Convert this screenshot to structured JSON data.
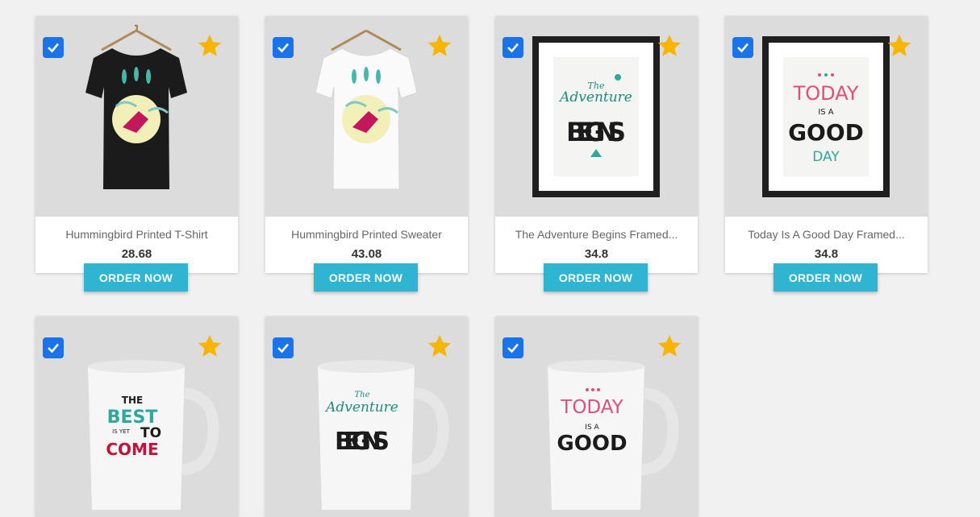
{
  "order_label": "ORDER NOW",
  "products": [
    {
      "name": "Hummingbird Printed T-Shirt",
      "price": "28.68",
      "image": "black-tshirt"
    },
    {
      "name": "Hummingbird Printed Sweater",
      "price": "43.08",
      "image": "white-tshirt"
    },
    {
      "name": "The Adventure Begins Framed...",
      "price": "34.8",
      "image": "framed-poster-adventure"
    },
    {
      "name": "Today Is A Good Day Framed...",
      "price": "34.8",
      "image": "framed-poster-today"
    },
    {
      "name": "",
      "price": "",
      "image": "mug-best-is-yet-to-come"
    },
    {
      "name": "",
      "price": "",
      "image": "mug-adventure-begins"
    },
    {
      "name": "",
      "price": "",
      "image": "mug-today-is-a-good-day"
    }
  ],
  "artwork_text": {
    "adventure_the": "The",
    "adventure_word": "Adventure",
    "adventure_begins": "BEGINS",
    "today_today": "TODAY",
    "today_isa": "IS A",
    "today_good": "GOOD",
    "today_day": "DAY",
    "best_the": "THE",
    "best_best": "BEST",
    "best_isyet": "IS YET",
    "best_to": "TO",
    "best_come": "COME"
  },
  "colors": {
    "checkbox": "#1a73e8",
    "star": "#f7b500",
    "button": "#2fb5d2",
    "image_bg": "#dcdcdc"
  }
}
